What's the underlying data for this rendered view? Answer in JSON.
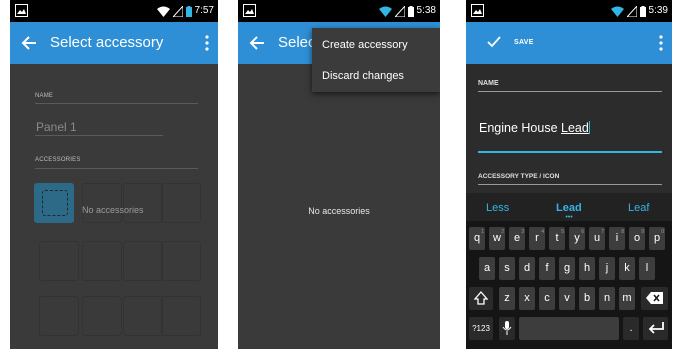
{
  "screen1": {
    "status_time": "7:57",
    "title": "Select accessory",
    "name_label": "NAME",
    "name_value": "Panel 1",
    "accessories_label": "ACCESSORIES",
    "no_accessories": "No accessories"
  },
  "screen2": {
    "status_time": "5:38",
    "title": "Select",
    "menu_items": [
      "Create accessory",
      "Discard changes"
    ],
    "no_accessories": "No accessories"
  },
  "screen3": {
    "status_time": "5:39",
    "save_label": "SAVE",
    "name_label": "NAME",
    "name_value_prefix": "Engine House ",
    "name_value_word": "Lead",
    "type_label": "ACCESSORY TYPE / ICON",
    "suggestions": [
      "Less",
      "Lead",
      "Leaf"
    ],
    "keyboard": {
      "row1": [
        "q",
        "w",
        "e",
        "r",
        "t",
        "y",
        "u",
        "i",
        "o",
        "p"
      ],
      "row1_hints": [
        "1",
        "2",
        "3",
        "4",
        "5",
        "6",
        "7",
        "8",
        "9",
        "0"
      ],
      "row2": [
        "a",
        "s",
        "d",
        "f",
        "g",
        "h",
        "j",
        "k",
        "l"
      ],
      "row3": [
        "z",
        "x",
        "c",
        "v",
        "b",
        "n",
        "m"
      ],
      "symbols": "?123",
      "period": "."
    }
  },
  "colors": {
    "appbar": "#2e8fd6",
    "accent": "#33b5e5",
    "background": "#3a3a3a"
  },
  "icons": [
    "image-icon",
    "wifi-icon",
    "signal-icon",
    "battery-icon",
    "back-arrow-icon",
    "overflow-menu-icon",
    "check-icon",
    "shift-icon",
    "backspace-icon",
    "mic-icon",
    "enter-icon"
  ]
}
